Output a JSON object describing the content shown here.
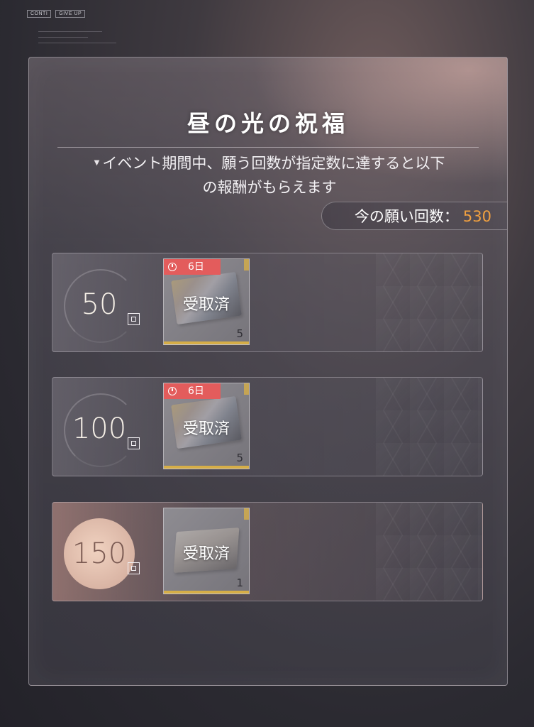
{
  "topbar": {
    "btn1": "CONTI",
    "btn2": "GIVE UP"
  },
  "panel": {
    "title": "昼の光の祝福",
    "description_line1": "イベント期間中、願う回数が指定数に達すると以下",
    "description_line2": "の報酬がもらえます",
    "count_label": "今の願い回数：",
    "count_value": "530"
  },
  "colors": {
    "accent": "#f0a040",
    "timer_bg": "#e35c5c",
    "gold": "#d6ae47"
  },
  "rewards": [
    {
      "threshold": "50",
      "unit_icon": "kai-icon",
      "timer": "6日",
      "status": "受取済",
      "quantity": "5",
      "item_icon": "ticket-icon",
      "reached": true
    },
    {
      "threshold": "100",
      "unit_icon": "kai-icon",
      "timer": "6日",
      "status": "受取済",
      "quantity": "5",
      "item_icon": "ticket-icon",
      "reached": true
    },
    {
      "threshold": "150",
      "unit_icon": "kai-icon",
      "timer": "",
      "status": "受取済",
      "quantity": "1",
      "item_icon": "gift-box-icon",
      "reached": true,
      "highlighted": true
    }
  ]
}
